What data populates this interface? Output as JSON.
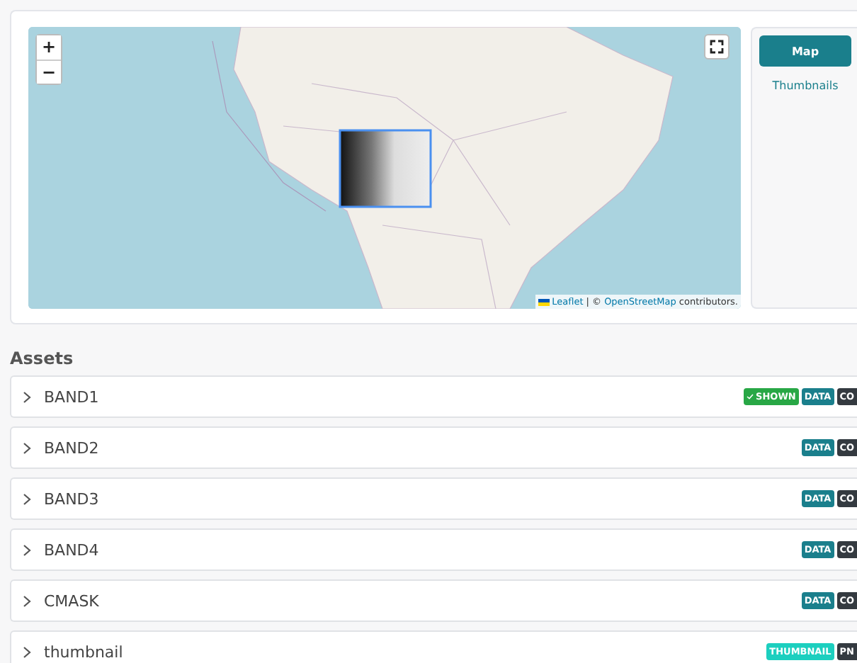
{
  "map": {
    "zoom_in": "+",
    "zoom_out": "−",
    "attribution": {
      "leaflet": "Leaflet",
      "separator": "| ©",
      "osm": "OpenStreetMap",
      "suffix": "contributors."
    }
  },
  "view_tabs": [
    {
      "label": "Map",
      "selected": true
    },
    {
      "label": "Thumbnails",
      "selected": false
    }
  ],
  "assets_heading": "Assets",
  "assets": [
    {
      "name": "BAND1",
      "expanded": false,
      "badges": [
        {
          "label": "SHOWN",
          "kind": "shown"
        },
        {
          "label": "DATA",
          "kind": "role"
        },
        {
          "label": "CO",
          "kind": "format"
        }
      ]
    },
    {
      "name": "BAND2",
      "expanded": false,
      "badges": [
        {
          "label": "DATA",
          "kind": "role"
        },
        {
          "label": "CO",
          "kind": "format"
        }
      ]
    },
    {
      "name": "BAND3",
      "expanded": false,
      "badges": [
        {
          "label": "DATA",
          "kind": "role"
        },
        {
          "label": "CO",
          "kind": "format"
        }
      ]
    },
    {
      "name": "BAND4",
      "expanded": false,
      "badges": [
        {
          "label": "DATA",
          "kind": "role"
        },
        {
          "label": "CO",
          "kind": "format"
        }
      ]
    },
    {
      "name": "CMASK",
      "expanded": false,
      "badges": [
        {
          "label": "DATA",
          "kind": "role"
        },
        {
          "label": "CO",
          "kind": "format"
        }
      ]
    },
    {
      "name": "thumbnail",
      "expanded": false,
      "badges": [
        {
          "label": "THUMBNAIL",
          "kind": "thumbnail"
        },
        {
          "label": "PN",
          "kind": "format"
        }
      ]
    }
  ]
}
